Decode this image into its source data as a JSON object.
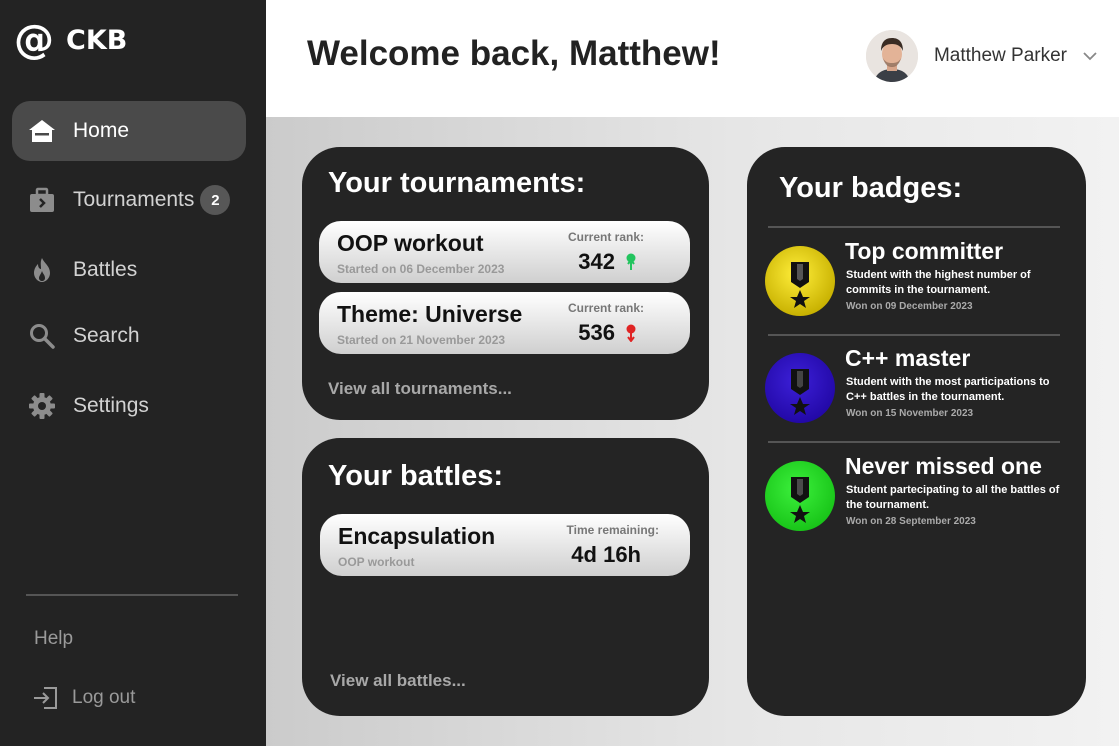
{
  "app": {
    "logo_mark": "@",
    "name": "CKB"
  },
  "sidebar": {
    "items": [
      {
        "label": "Home",
        "icon": "home-icon",
        "active": true
      },
      {
        "label": "Tournaments",
        "icon": "briefcase-icon",
        "badge": "2"
      },
      {
        "label": "Battles",
        "icon": "flame-icon"
      },
      {
        "label": "Search",
        "icon": "search-icon"
      },
      {
        "label": "Settings",
        "icon": "gear-icon"
      }
    ],
    "help": "Help",
    "logout": "Log out"
  },
  "header": {
    "welcome": "Welcome back, Matthew!",
    "user_name": "Matthew Parker"
  },
  "tournaments": {
    "title": "Your tournaments:",
    "rank_label": "Current rank:",
    "items": [
      {
        "name": "OOP workout",
        "started": "Started on 06 December 2023",
        "rank": "342",
        "trend": "up"
      },
      {
        "name": "Theme: Universe",
        "started": "Started on 21 November 2023",
        "rank": "536",
        "trend": "down"
      }
    ],
    "view_all": "View all tournaments..."
  },
  "battles": {
    "title": "Your battles:",
    "time_label": "Time remaining:",
    "items": [
      {
        "name": "Encapsulation",
        "tournament": "OOP workout",
        "time": "4d 16h"
      }
    ],
    "view_all": "View all battles..."
  },
  "badges": {
    "title": "Your badges:",
    "items": [
      {
        "name": "Top committer",
        "desc": "Student with the highest number of commits in the tournament.",
        "won": "Won on 09 December 2023",
        "color": "#e8d20a"
      },
      {
        "name": "C++ master",
        "desc": "Student with the most participations to C++ battles in the tournament.",
        "won": "Won on 15 November 2023",
        "color": "#2a0fb0"
      },
      {
        "name": "Never missed one",
        "desc": "Student partecipating to all the battles of the tournament.",
        "won": "Won on 28 September 2023",
        "color": "#18c418"
      }
    ]
  },
  "colors": {
    "sidebar_bg": "#232323",
    "panel_bg": "#242424",
    "rank_up": "#22c45e",
    "rank_down": "#e02424"
  }
}
